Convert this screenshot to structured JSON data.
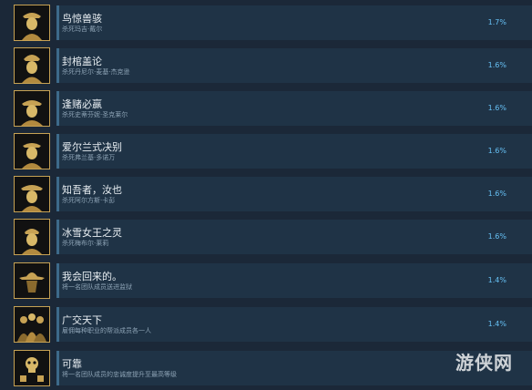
{
  "achievements": [
    {
      "title": "鸟惊兽骇",
      "desc": "杀死玛吉·戴尔",
      "percent": "1.7%",
      "icon": "outlaw-portrait-icon"
    },
    {
      "title": "封棺盖论",
      "desc": "杀死丹尼尔·麦基·杰克逊",
      "percent": "1.6%",
      "icon": "outlaw-portrait-icon"
    },
    {
      "title": "逢赌必赢",
      "desc": "杀死史蒂芬妮·圣克莱尔",
      "percent": "1.6%",
      "icon": "outlaw-portrait-icon"
    },
    {
      "title": "爱尔兰式决别",
      "desc": "杀死弗兰基·多诺万",
      "percent": "1.6%",
      "icon": "outlaw-portrait-icon"
    },
    {
      "title": "知吾者，汝也",
      "desc": "杀死阿尔方斯·卡彭",
      "percent": "1.6%",
      "icon": "outlaw-portrait-icon"
    },
    {
      "title": "冰雪女王之灵",
      "desc": "杀死梅布尔·莱莉",
      "percent": "1.6%",
      "icon": "outlaw-portrait-icon"
    },
    {
      "title": "我会回来的。",
      "desc": "将一名团队成员送进监狱",
      "percent": "1.4%",
      "icon": "hat-silhouette-icon"
    },
    {
      "title": "广交天下",
      "desc": "雇佣每种职业的帮派成员各一人",
      "percent": "1.4%",
      "icon": "gang-group-icon"
    },
    {
      "title": "可靠",
      "desc": "将一名团队成员的忠诚度提升至最高等级",
      "percent": "",
      "icon": "skull-dice-icon"
    }
  ],
  "watermark": "游侠网"
}
